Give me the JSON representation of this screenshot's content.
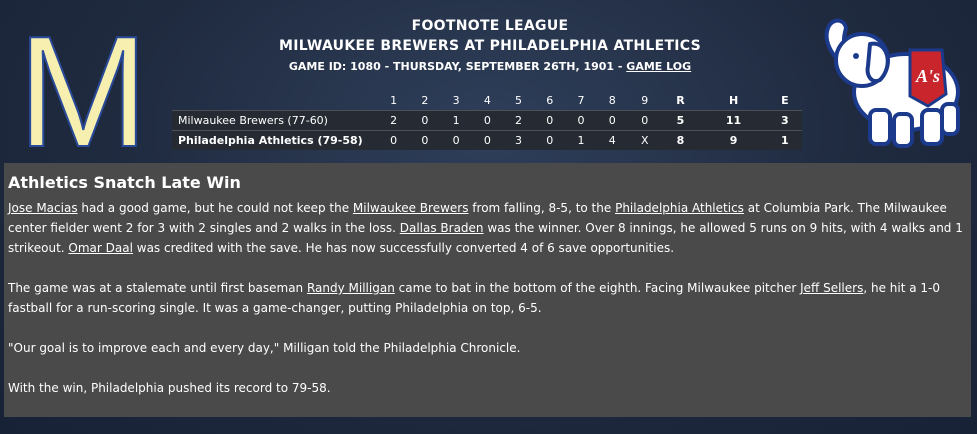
{
  "header": {
    "league": "FOOTNOTE LEAGUE",
    "matchup": "MILWAUKEE BREWERS AT PHILADELPHIA ATHLETICS",
    "game_info": "GAME ID: 1080 - THURSDAY, SEPTEMBER 26TH, 1901 - ",
    "game_log_link": "GAME LOG"
  },
  "logos": {
    "left_letter": "M",
    "left_color": "#f6efb0",
    "right_badge_text": "A's",
    "right_badge_color": "#c8252c",
    "right_outline_color": "#1c3a8c"
  },
  "boxscore": {
    "columns": [
      "1",
      "2",
      "3",
      "4",
      "5",
      "6",
      "7",
      "8",
      "9",
      "R",
      "H",
      "E"
    ],
    "rows": [
      {
        "team": "Milwaukee Brewers (77-60)",
        "cells": [
          "2",
          "0",
          "1",
          "0",
          "2",
          "0",
          "0",
          "0",
          "0",
          "5",
          "11",
          "3"
        ]
      },
      {
        "team": "Philadelphia Athletics (79-58)",
        "cells": [
          "0",
          "0",
          "0",
          "0",
          "3",
          "0",
          "1",
          "4",
          "X",
          "8",
          "9",
          "1"
        ]
      }
    ]
  },
  "article": {
    "headline": "Athletics Snatch Late Win",
    "p1": {
      "link_macias": "Jose Macias",
      "t1": " had a good game, but he could not keep the ",
      "link_brewers": "Milwaukee Brewers",
      "t2": " from falling, 8-5, to the ",
      "link_athletics": "Philadelphia Athletics",
      "t3": " at Columbia Park. The Milwaukee center fielder went 2 for 3 with 2 singles and 2 walks in the loss. ",
      "link_braden": "Dallas Braden",
      "t4": " was the winner. Over 8 innings, he allowed 5 runs on 9 hits, with 4 walks and 1 strikeout. ",
      "link_daal": "Omar Daal",
      "t5": " was credited with the save. He has now successfully converted 4 of 6 save opportunities."
    },
    "p2": {
      "t1": "The game was at a stalemate until first baseman ",
      "link_milligan": "Randy Milligan",
      "t2": " came to bat in the bottom of the eighth. Facing Milwaukee pitcher ",
      "link_sellers": "Jeff Sellers",
      "t3": ", he hit a 1-0 fastball for a run-scoring single. It was a game-changer, putting Philadelphia on top, 6-5."
    },
    "p3": "\"Our goal is to improve each and every day,\" Milligan told the Philadelphia Chronicle.",
    "p4": "With the win, Philadelphia pushed its record to 79-58."
  }
}
